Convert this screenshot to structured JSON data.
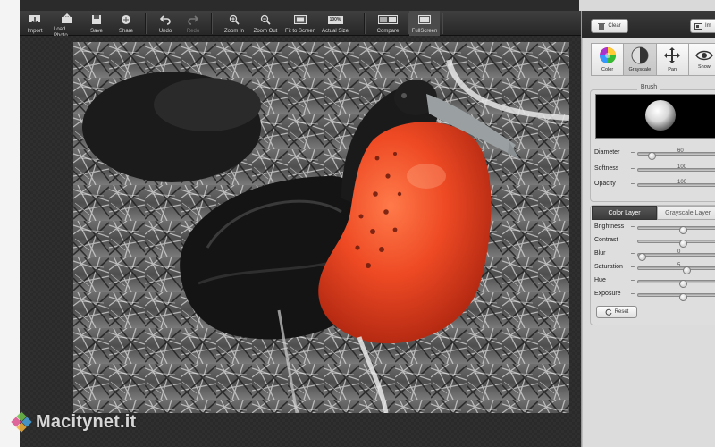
{
  "toolbar": {
    "items": [
      {
        "label": "Import",
        "icon": "import-icon"
      },
      {
        "label": "Load Photo",
        "icon": "load-photo-icon"
      },
      {
        "label": "Save",
        "icon": "save-icon"
      },
      {
        "label": "Share",
        "icon": "share-icon"
      },
      {
        "label": "Undo",
        "icon": "undo-icon"
      },
      {
        "label": "Redo",
        "icon": "redo-icon",
        "disabled": true
      },
      {
        "label": "Zoom In",
        "icon": "zoom-in-icon"
      },
      {
        "label": "Zoom Out",
        "icon": "zoom-out-icon"
      },
      {
        "label": "Fit to Screen",
        "icon": "fit-to-screen-icon"
      },
      {
        "label": "Actual Size",
        "icon": "actual-size-icon"
      },
      {
        "label": "Compare",
        "icon": "compare-icon"
      },
      {
        "label": "FullScreen",
        "icon": "fullscreen-icon"
      }
    ],
    "actual_size_badge": "100%"
  },
  "panel": {
    "clear_label": "Clear",
    "top_right_label": "Im",
    "modes": [
      {
        "label": "Color",
        "icon": "color-wheel-icon"
      },
      {
        "label": "Grayscale",
        "icon": "grayscale-icon"
      },
      {
        "label": "Pan",
        "icon": "pan-icon"
      },
      {
        "label": "Show",
        "icon": "eye-icon"
      }
    ],
    "brush": {
      "title": "Brush",
      "sliders": [
        {
          "label": "Diameter",
          "value": "60",
          "fraction": 0.12
        },
        {
          "label": "Softness",
          "value": "100",
          "fraction": 1.0
        },
        {
          "label": "Opacity",
          "value": "100",
          "fraction": 1.0
        }
      ]
    },
    "layer_tabs": [
      "Color Layer",
      "Grayscale Layer"
    ],
    "layer_sliders": [
      {
        "label": "Brightness",
        "value": "",
        "fraction": 0.5
      },
      {
        "label": "Contrast",
        "value": "",
        "fraction": 0.5
      },
      {
        "label": "Blur",
        "value": "0",
        "fraction": 0.0
      },
      {
        "label": "Saturation",
        "value": "5",
        "fraction": 0.55
      },
      {
        "label": "Hue",
        "value": "",
        "fraction": 0.5
      },
      {
        "label": "Exposure",
        "value": "",
        "fraction": 0.5
      }
    ],
    "reset_label": "Reset"
  },
  "watermark": {
    "text": "Macitynet.it"
  },
  "colors": {
    "accent_red": "#e2442a",
    "toolbar": "#333333",
    "panel": "#dcdcdc"
  }
}
